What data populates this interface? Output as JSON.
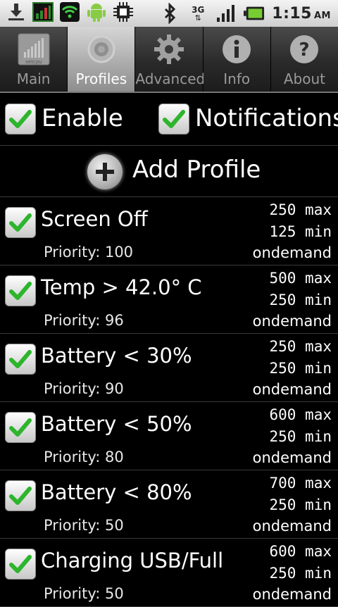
{
  "status_bar": {
    "icons": [
      "download-icon",
      "setcpu-icon",
      "wifi-shield-icon",
      "android-icon",
      "cpu-chip-icon"
    ],
    "right_icons": [
      "bluetooth-icon",
      "3g-icon",
      "signal-icon",
      "battery-icon"
    ],
    "network": "3G",
    "time": "1:15",
    "ampm": "AM"
  },
  "tabs": [
    {
      "label": "Main",
      "icon": "setcpu-logo-icon",
      "active": false
    },
    {
      "label": "Profiles",
      "icon": "gear-icon",
      "active": true
    },
    {
      "label": "Advanced",
      "icon": "cog-icon",
      "active": false
    },
    {
      "label": "Info",
      "icon": "info-icon",
      "active": false
    },
    {
      "label": "About",
      "icon": "help-icon",
      "active": false
    }
  ],
  "main_tab_icon_text": "setcpu",
  "toggles": {
    "enable": {
      "label": "Enable",
      "checked": true
    },
    "notifications": {
      "label": "Notifications",
      "checked": true
    }
  },
  "add_profile": {
    "label": "Add Profile"
  },
  "profiles": [
    {
      "name": "Screen Off",
      "priority": "Priority: 100",
      "max": "250 max",
      "min": "125 min",
      "governor": "ondemand",
      "checked": true
    },
    {
      "name": "Temp > 42.0° C",
      "priority": "Priority: 96",
      "max": "500 max",
      "min": "250 min",
      "governor": "ondemand",
      "checked": true
    },
    {
      "name": "Battery < 30%",
      "priority": "Priority: 90",
      "max": "250 max",
      "min": "250 min",
      "governor": "ondemand",
      "checked": true
    },
    {
      "name": "Battery < 50%",
      "priority": "Priority: 80",
      "max": "600 max",
      "min": "250 min",
      "governor": "ondemand",
      "checked": true
    },
    {
      "name": "Battery < 80%",
      "priority": "Priority: 50",
      "max": "700 max",
      "min": "250 min",
      "governor": "ondemand",
      "checked": true
    },
    {
      "name": "Charging USB/Full",
      "priority": "Priority: 50",
      "max": "600 max",
      "min": "250 min",
      "governor": "ondemand",
      "checked": true
    }
  ],
  "colors": {
    "check": "#2db52d",
    "active_tab": "#b8b8b8",
    "background": "#000000"
  }
}
